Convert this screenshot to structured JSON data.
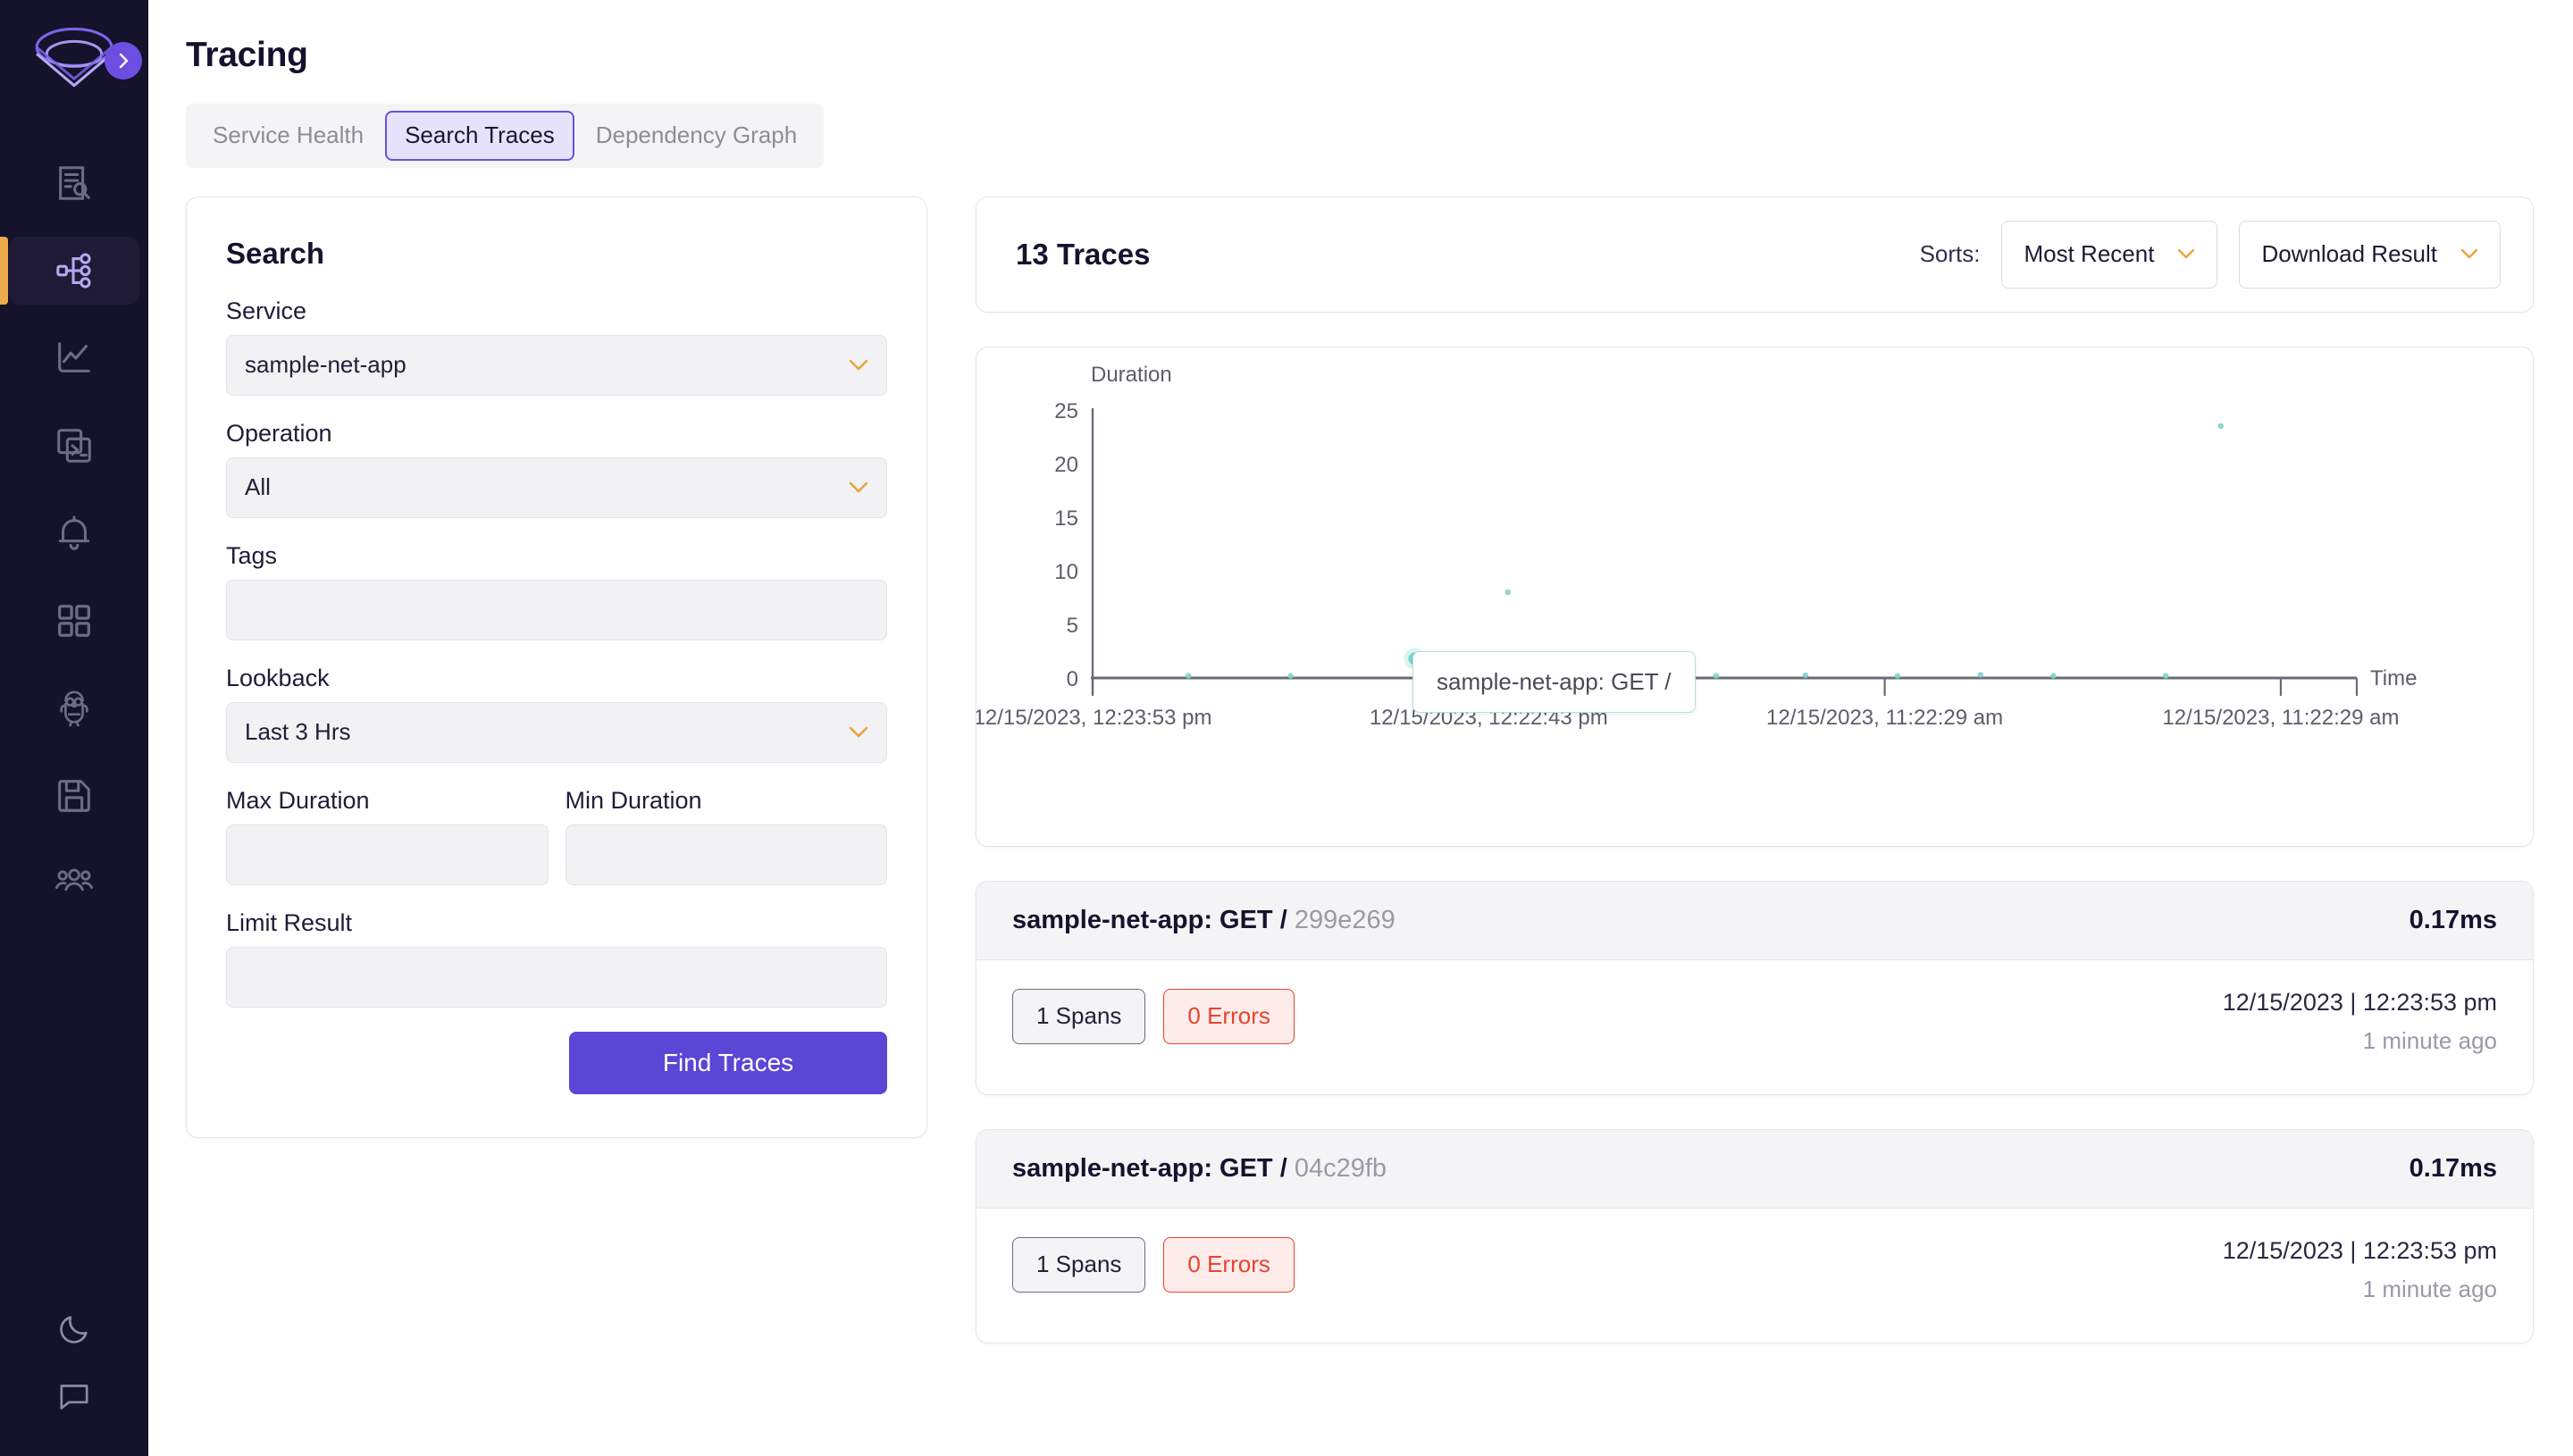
{
  "sidebar": {
    "logo_name": "signoz-logo",
    "expand_label": "expand-sidebar",
    "items": [
      {
        "icon": "logs-search-icon",
        "name": "sidebar-item-logs",
        "active": false
      },
      {
        "icon": "traces-tree-icon",
        "name": "sidebar-item-traces",
        "active": true
      },
      {
        "icon": "metrics-chart-icon",
        "name": "sidebar-item-metrics",
        "active": false
      },
      {
        "icon": "terminal-window-icon",
        "name": "sidebar-item-exceptions",
        "active": false
      },
      {
        "icon": "bell-icon",
        "name": "sidebar-item-alerts",
        "active": false
      },
      {
        "icon": "grid-icon",
        "name": "sidebar-item-dashboards",
        "active": false
      },
      {
        "icon": "owl-bot-icon",
        "name": "sidebar-item-assistant",
        "active": false
      },
      {
        "icon": "save-disk-icon",
        "name": "sidebar-item-saved-views",
        "active": false
      },
      {
        "icon": "people-icon",
        "name": "sidebar-item-members",
        "active": false
      }
    ],
    "bottom_items": [
      {
        "icon": "moon-icon",
        "name": "sidebar-item-dark-mode"
      },
      {
        "icon": "chat-bubble-icon",
        "name": "sidebar-item-support"
      }
    ]
  },
  "header": {
    "title": "Tracing"
  },
  "tabs": [
    {
      "label": "Service Health",
      "active": false
    },
    {
      "label": "Search Traces",
      "active": true
    },
    {
      "label": "Dependency Graph",
      "active": false
    }
  ],
  "search": {
    "title": "Search",
    "service": {
      "label": "Service",
      "value": "sample-net-app"
    },
    "operation": {
      "label": "Operation",
      "value": "All"
    },
    "tags": {
      "label": "Tags",
      "value": "",
      "placeholder": ""
    },
    "lookback": {
      "label": "Lookback",
      "value": "Last 3 Hrs"
    },
    "max_duration": {
      "label": "Max Duration",
      "value": "",
      "placeholder": ""
    },
    "min_duration": {
      "label": "Min Duration",
      "value": "",
      "placeholder": ""
    },
    "limit_result": {
      "label": "Limit Result",
      "value": "",
      "placeholder": ""
    },
    "find_button": "Find Traces"
  },
  "results": {
    "count_label": "13 Traces",
    "sorts_label": "Sorts:",
    "sort_value": "Most Recent",
    "download_label": "Download Result"
  },
  "chart_data": {
    "type": "scatter",
    "title": "",
    "ylabel": "Duration",
    "xlabel": "Time",
    "ylim": [
      0,
      25
    ],
    "yticks": [
      0,
      5,
      10,
      15,
      20,
      25
    ],
    "ytick_labels": [
      "0",
      "5",
      "10",
      "15",
      "20",
      "25"
    ],
    "xtick_labels": [
      "12/15/2023, 12:23:53 pm",
      "12/15/2023, 12:22:43 pm",
      "12/15/2023, 11:22:29 am",
      "12/15/2023, 11:22:29 am"
    ],
    "xtick_positions": [
      0.0,
      0.31,
      0.62,
      0.93
    ],
    "grid": false,
    "legend": false,
    "point_color": "#7fd4cd",
    "series": [
      {
        "name": "sample-net-app: GET /",
        "points": [
          {
            "x": 0.075,
            "y": 0.2
          },
          {
            "x": 0.155,
            "y": 0.2
          },
          {
            "x": 0.252,
            "y": 1.8,
            "hovered": true
          },
          {
            "x": 0.345,
            "y": 0.25
          },
          {
            "x": 0.417,
            "y": 0.2
          },
          {
            "x": 0.488,
            "y": 0.2
          },
          {
            "x": 0.558,
            "y": 0.25
          },
          {
            "x": 0.63,
            "y": 0.2
          },
          {
            "x": 0.695,
            "y": 0.3
          },
          {
            "x": 0.752,
            "y": 0.2
          },
          {
            "x": 0.84,
            "y": 0.2
          },
          {
            "x": 0.325,
            "y": 8.0
          },
          {
            "x": 0.883,
            "y": 23.5
          }
        ]
      }
    ],
    "tooltip": {
      "text": "sample-net-app: GET /",
      "border_color": "#b6dedd"
    }
  },
  "traces": [
    {
      "service_op": "sample-net-app: GET /",
      "trace_id": "299e269",
      "duration": "0.17ms",
      "spans": "1 Spans",
      "errors": "0 Errors",
      "timestamp": "12/15/2023 | 12:23:53 pm",
      "relative": "1 minute ago"
    },
    {
      "service_op": "sample-net-app: GET /",
      "trace_id": "04c29fb",
      "duration": "0.17ms",
      "spans": "1 Spans",
      "errors": "0 Errors",
      "timestamp": "12/15/2023 | 12:23:53 pm",
      "relative": "1 minute ago"
    }
  ],
  "colors": {
    "accent_purple": "#5b46d6",
    "sidebar_bg": "#15122b",
    "active_bar": "#edaa4a",
    "chevron": "#eaa33c",
    "error_red": "#e8432e",
    "chart_point": "#7fd4cd"
  }
}
